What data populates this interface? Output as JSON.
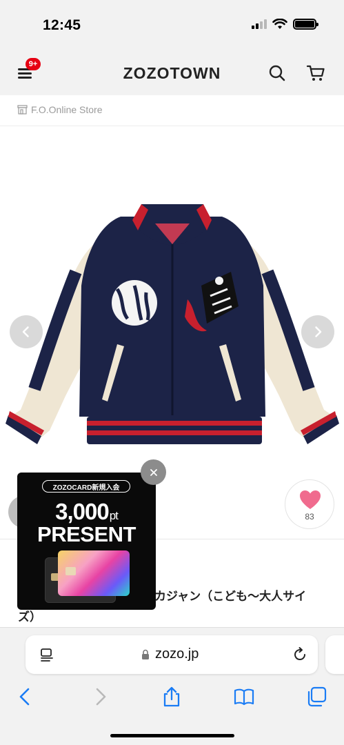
{
  "status_bar": {
    "time": "12:45"
  },
  "header": {
    "logo": "ZOZOTOWN",
    "menu_badge": "9+"
  },
  "store": {
    "name": "F.O.Online Store"
  },
  "favorite": {
    "count": "83",
    "color": "#f06b8e"
  },
  "product": {
    "name": "カジャン（こども〜大人サイ\nズ）"
  },
  "promo": {
    "pill": "ZOZOCARD新規入会",
    "amount": "3,000",
    "unit": "pt",
    "headline": "PRESENT"
  },
  "browser": {
    "url": "zozo.jp"
  },
  "colors": {
    "accent_badge": "#e60012",
    "ios_blue": "#1a7cf5",
    "navy": "#1c2347"
  }
}
